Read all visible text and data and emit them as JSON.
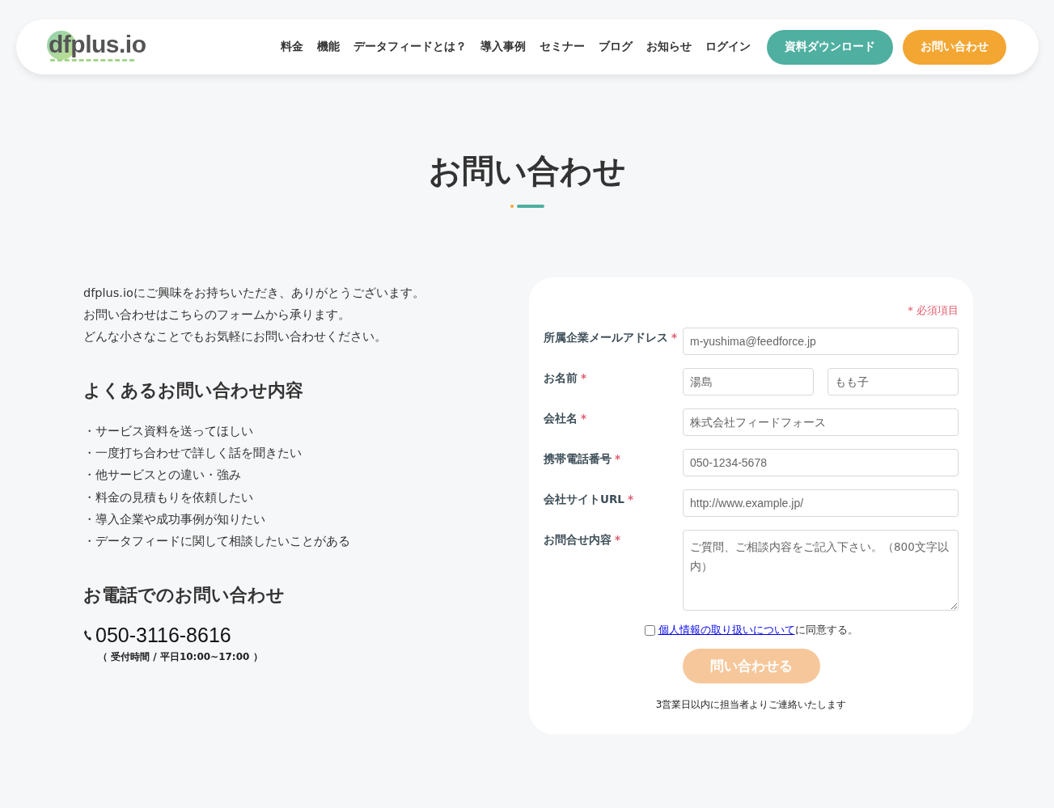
{
  "header": {
    "logo": "dfplus.io",
    "nav": [
      "料金",
      "機能",
      "データフィードとは？",
      "導入事例",
      "セミナー",
      "ブログ",
      "お知らせ",
      "ログイン"
    ],
    "buttons": [
      {
        "kind": "download",
        "label": "資料ダウンロード"
      },
      {
        "kind": "contact",
        "label": "お問い合わせ"
      }
    ]
  },
  "page_title": "お問い合わせ",
  "intro": [
    "dfplus.ioにご興味をお持ちいただき、ありがとうございます。",
    "お問い合わせはこちらのフォームから承ります。",
    "どんな小さなことでもお気軽にお問い合わせください。"
  ],
  "faq": {
    "heading": "よくあるお問い合わせ内容",
    "items": [
      "・サービス資料を送ってほしい",
      "・一度打ち合わせで詳しく話を聞きたい",
      "・他サービスとの違い・強み",
      "・料金の見積もりを依頼したい",
      "・導入企業や成功事例が知りたい",
      "・データフィードに関して相談したいことがある"
    ]
  },
  "phone": {
    "heading": "お電話でのお問い合わせ",
    "number": "050-3116-8616",
    "hours": "（ 受付時間 / 平日10:00~17:00 ）"
  },
  "form": {
    "required_note": "* 必須項目",
    "fields": [
      {
        "kind": "input",
        "label": "所属企業メールアドレス",
        "required_mark": "*",
        "placeholders": [
          "m-yushima@feedforce.jp"
        ]
      },
      {
        "kind": "input",
        "label": "お名前",
        "required_mark": "*",
        "placeholders": [
          "湯島",
          "もも子"
        ]
      },
      {
        "kind": "input",
        "label": "会社名",
        "required_mark": "*",
        "placeholders": [
          "株式会社フィードフォース"
        ]
      },
      {
        "kind": "input",
        "label": "携帯電話番号",
        "required_mark": "*",
        "placeholders": [
          "050-1234-5678"
        ]
      },
      {
        "kind": "input",
        "label": "会社サイトURL",
        "required_mark": "*",
        "placeholders": [
          "http://www.example.jp/"
        ]
      },
      {
        "kind": "textarea",
        "label": "お問合せ内容",
        "required_mark": "*",
        "placeholders": [
          "ご質問、ご相談内容をご記入下さい。（800文字以内）"
        ]
      }
    ],
    "consent": {
      "checked": false,
      "link": "個人情報の取り扱いについて",
      "text": "に同意する。"
    },
    "submit": {
      "label": "問い合わせる",
      "disabled": true
    },
    "footnote": "3営業日以内に担当者よりご連絡いたします"
  }
}
